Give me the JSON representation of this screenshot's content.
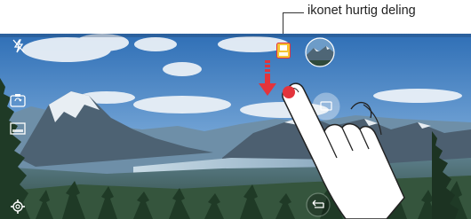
{
  "callout": {
    "label": "ikonet hurtig deling"
  },
  "icons": {
    "flash": "flash-off-icon",
    "switch_camera": "switch-camera-icon",
    "gallery_thumb": "gallery-thumbnail-icon",
    "mode": "mode-icon",
    "settings": "gear-icon",
    "share": "quick-share-icon",
    "back": "back-icon"
  },
  "colors": {
    "accent_red": "#e3343c",
    "share_icon": "#f4c430"
  }
}
